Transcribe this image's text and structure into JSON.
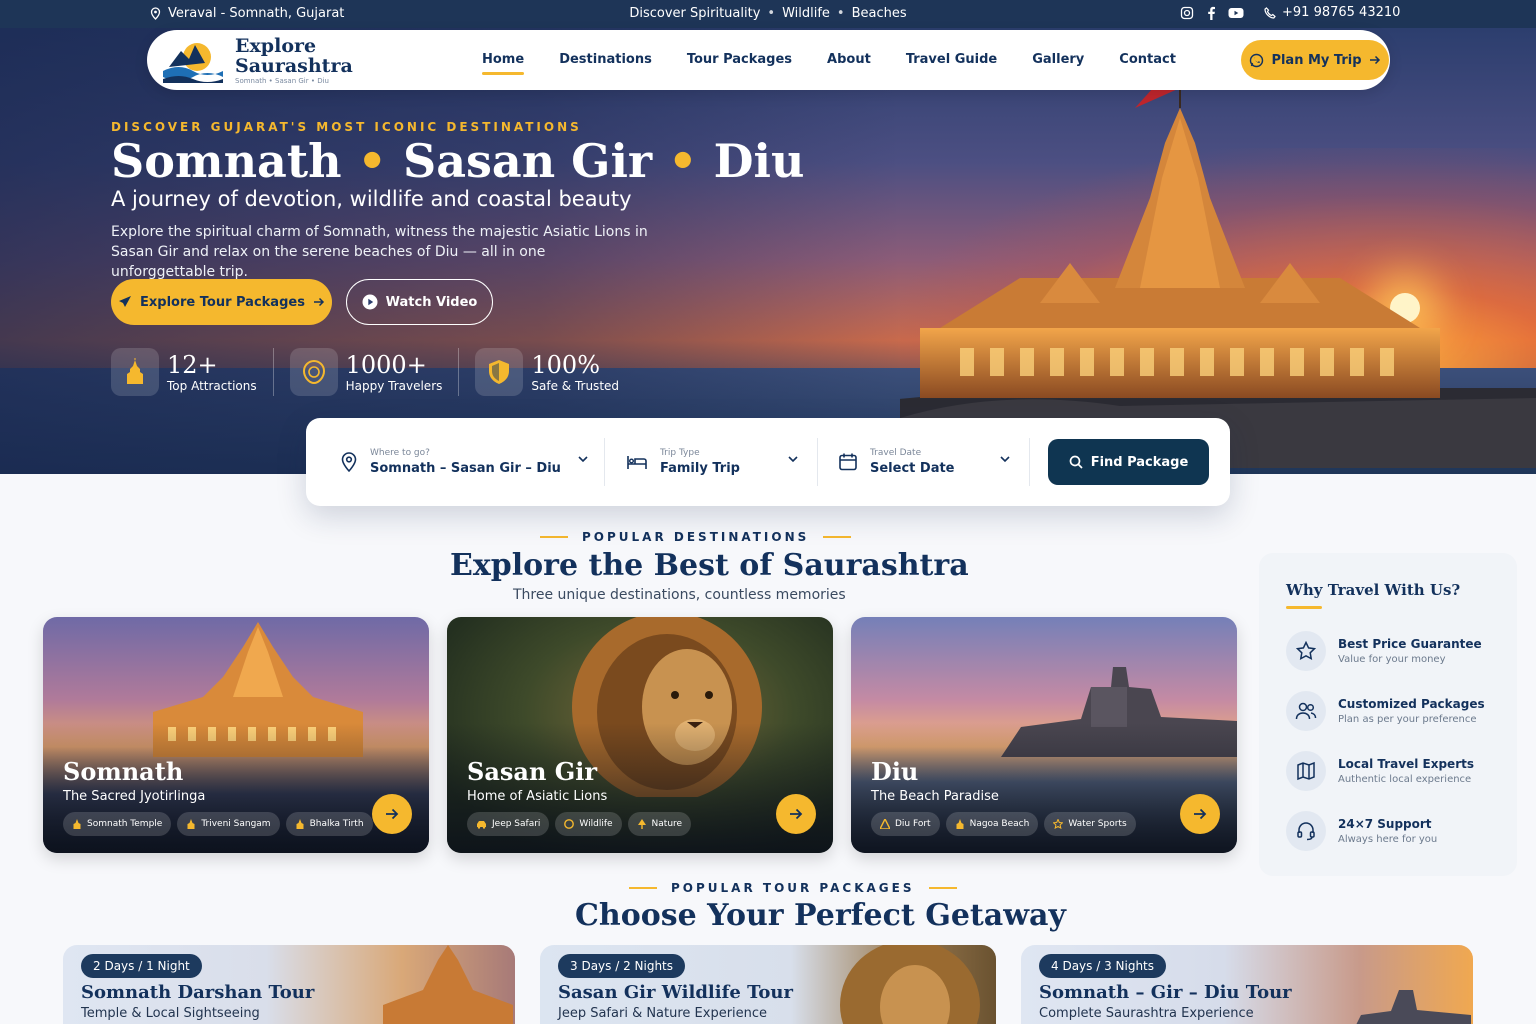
{
  "topbar": {
    "location": "Veraval - Somnath, Gujarat",
    "themes": [
      "Discover Spirituality",
      "Wildlife",
      "Beaches"
    ],
    "phone": "+91 98765 43210"
  },
  "nav": {
    "logo_line1": "Explore",
    "logo_line2": "Saurashtra",
    "logo_tagline": "Somnath • Sasan Gir • Diu",
    "items": [
      "Home",
      "Destinations",
      "Tour Packages",
      "About",
      "Travel Guide",
      "Gallery",
      "Contact"
    ],
    "active": "Home",
    "cta": "Plan My Trip"
  },
  "hero": {
    "eyebrow": "DISCOVER GUJARAT'S MOST ICONIC DESTINATIONS",
    "title_parts": [
      "Somnath",
      "Sasan Gir",
      "Diu"
    ],
    "subtitle": "A journey of devotion, wildlife and coastal beauty",
    "description": "Explore the spiritual charm of Somnath, witness the majestic Asiatic Lions in Sasan Gir and relax on the serene beaches of Diu — all in one unforggettable trip.",
    "primary_cta": "Explore Tour Packages",
    "secondary_cta": "Watch Video",
    "stats": [
      {
        "value": "12+",
        "label": "Top Attractions",
        "icon": "temple-icon"
      },
      {
        "value": "1000+",
        "label": "Happy Travelers",
        "icon": "lion-icon"
      },
      {
        "value": "100%",
        "label": "Safe & Trusted",
        "icon": "shield-icon"
      }
    ]
  },
  "search": {
    "where_label": "Where to go?",
    "where_value": "Somnath – Sasan Gir – Diu",
    "trip_label": "Trip Type",
    "trip_value": "Family Trip",
    "date_label": "Travel Date",
    "date_value": "Select Date",
    "button": "Find Package"
  },
  "destinations": {
    "eyebrow": "POPULAR DESTINATIONS",
    "title": "Explore the Best of Saurashtra",
    "subtitle": "Three unique destinations, countless memories",
    "cards": [
      {
        "name": "Somnath",
        "tagline": "The Sacred Jyotirlinga",
        "chips": [
          "Somnath Temple",
          "Triveni Sangam",
          "Bhalka Tirth"
        ]
      },
      {
        "name": "Sasan Gir",
        "tagline": "Home of Asiatic Lions",
        "chips": [
          "Jeep Safari",
          "Wildlife",
          "Nature"
        ]
      },
      {
        "name": "Diu",
        "tagline": "The Beach Paradise",
        "chips": [
          "Diu Fort",
          "Nagoa Beach",
          "Water Sports"
        ]
      }
    ]
  },
  "why": {
    "title": "Why Travel With Us?",
    "items": [
      {
        "title": "Best Price Guarantee",
        "sub": "Value for your money",
        "icon": "star-icon"
      },
      {
        "title": "Customized Packages",
        "sub": "Plan as per your preference",
        "icon": "users-icon"
      },
      {
        "title": "Local Travel Experts",
        "sub": "Authentic local experience",
        "icon": "map-icon"
      },
      {
        "title": "24×7 Support",
        "sub": "Always here for you",
        "icon": "headset-icon"
      }
    ]
  },
  "packages": {
    "eyebrow": "POPULAR TOUR PACKAGES",
    "title": "Choose Your Perfect Getaway",
    "cards": [
      {
        "duration": "2 Days / 1 Night",
        "title": "Somnath Darshan Tour",
        "sub": "Temple & Local Sightseeing"
      },
      {
        "duration": "3 Days / 2 Nights",
        "title": "Sasan Gir Wildlife Tour",
        "sub": "Jeep Safari & Nature Experience"
      },
      {
        "duration": "4 Days / 3 Nights",
        "title": "Somnath – Gir – Diu Tour",
        "sub": "Complete Saurashtra Experience"
      }
    ]
  },
  "colors": {
    "accent": "#f5b82e",
    "navy": "#13315c",
    "button_dark": "#0f3551"
  }
}
